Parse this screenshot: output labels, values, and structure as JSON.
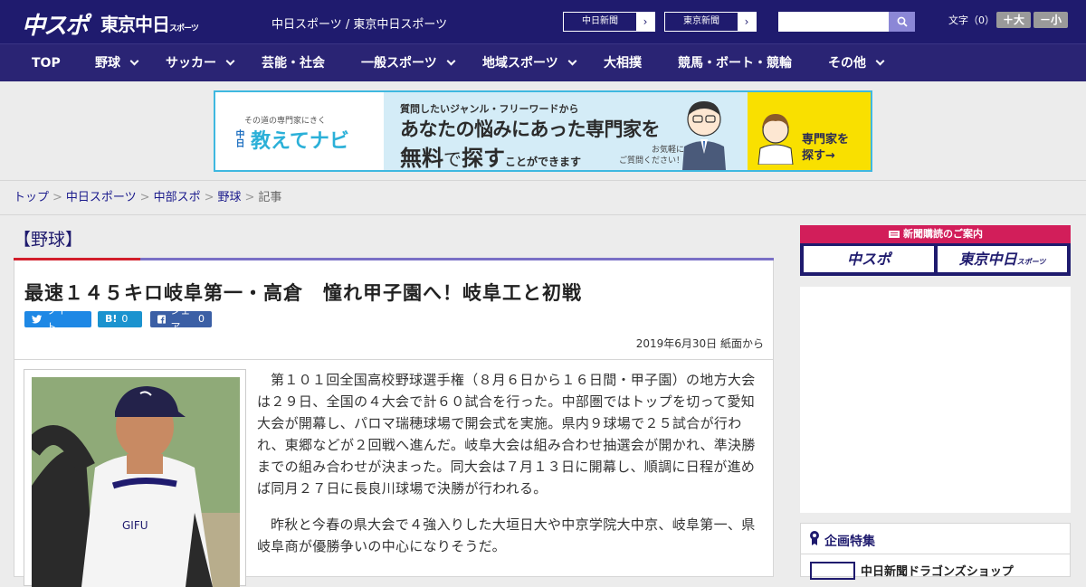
{
  "header": {
    "logo_primary": "中スポ",
    "logo_secondary": "東京中日",
    "logo_secondary_sub": "スポーツ",
    "site_names": "中日スポーツ / 東京中日スポーツ",
    "link_chunichi": "中日新聞",
    "link_tokyo": "東京新聞",
    "search_placeholder": "",
    "text_size_label": "文字（0）",
    "size_up": "＋大",
    "size_down": "－小"
  },
  "nav": {
    "items": [
      {
        "label": "TOP"
      },
      {
        "label": "野球"
      },
      {
        "label": "サッカー"
      },
      {
        "label": "芸能・社会"
      },
      {
        "label": "一般スポーツ"
      },
      {
        "label": "地域スポーツ"
      },
      {
        "label": "大相撲"
      },
      {
        "label": "競馬・ボート・競輪"
      },
      {
        "label": "その他"
      }
    ]
  },
  "banner": {
    "small": "その道の専門家にきく",
    "logo_chu": "中日",
    "logo": "教えてナビ",
    "line1": "質問したいジャンル・フリーワードから",
    "line2": "あなたの悩みにあった専門家を",
    "line3_a": "無料",
    "line3_b": "で",
    "line3_c": "探す",
    "line3_d": "ことができます",
    "note1": "お気軽に",
    "note2": "ご質問ください！",
    "cta1": "専門家を",
    "cta2": "探す→"
  },
  "breadcrumb": [
    "トップ",
    "中日スポーツ",
    "中部スポ",
    "野球",
    "記事"
  ],
  "category": "【野球】",
  "article": {
    "title": "最速１４５キロ岐阜第一・高倉　憧れ甲子園へ！岐阜工と初戦",
    "tweet": "ツイート",
    "hatena_label": "B!",
    "hatena_count": "0",
    "share_label": "シェア",
    "share_count": "0",
    "date": "2019年6月30日 紙面から",
    "paragraphs": [
      "第１０１回全国高校野球選手権（８月６日から１６日間・甲子園）の地方大会は２９日、全国の４大会で計６０試合を行った。中部圏ではトップを切って愛知大会が開幕し、パロマ瑞穂球場で開会式を実施。県内９球場で２５試合が行われ、東郷などが２回戦へ進んだ。岐阜大会は組み合わせ抽選会が開かれ、準決勝までの組み合わせが決まった。同大会は７月１３日に開幕し、順調に日程が進めば同月２７日に長良川球場で決勝が行われる。",
      "昨秋と今春の県大会で４強入りした大垣日大や中京学院大中京、岐阜第一、県岐阜商が優勝争いの中心になりそうだ。"
    ]
  },
  "sidebar": {
    "subscribe_header": "新聞購読のご案内",
    "sub_chuspo": "中スポ",
    "sub_tokyo": "東京中日",
    "sub_tokyo_small": "スポーツ",
    "feature_label": "企画特集",
    "feature_item": "中日新聞ドラゴンズショップ"
  },
  "colors": {
    "header_bg": "#1f1b6e",
    "nav_bg": "#2a2474",
    "accent_red": "#d21e2b",
    "accent_purple": "#7a70c6"
  }
}
